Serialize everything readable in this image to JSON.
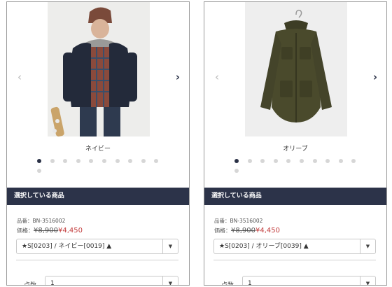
{
  "products": [
    {
      "color_label": "ネイビー",
      "section_title": "選択している商品",
      "code": "品番：BN-3516002",
      "price_label": "価格：",
      "original_price": "¥8,900",
      "sale_price": "¥4,450",
      "variant_selected": "★S[0203] / ネイビー[0019] ▲",
      "qty_label": "点数",
      "qty_value": "1",
      "prev_icon": "chevron-left-icon",
      "next_icon": "chevron-right-icon",
      "dropdown_icon": "caret-down-icon",
      "carousel": {
        "total": 11,
        "active": 1
      }
    },
    {
      "color_label": "オリーブ",
      "section_title": "選択している商品",
      "code": "品番：BN-3516002",
      "price_label": "価格：",
      "original_price": "¥8,900",
      "sale_price": "¥4,450",
      "variant_selected": "★S[0203] / オリーブ[0039] ▲",
      "qty_label": "点数",
      "qty_value": "1",
      "prev_icon": "chevron-left-icon",
      "next_icon": "chevron-right-icon",
      "dropdown_icon": "caret-down-icon",
      "carousel": {
        "total": 11,
        "active": 1
      }
    }
  ],
  "colors": {
    "header_bg": "#2c3349",
    "dot_active": "#2a3146",
    "sale_price": "#c23b3b"
  }
}
